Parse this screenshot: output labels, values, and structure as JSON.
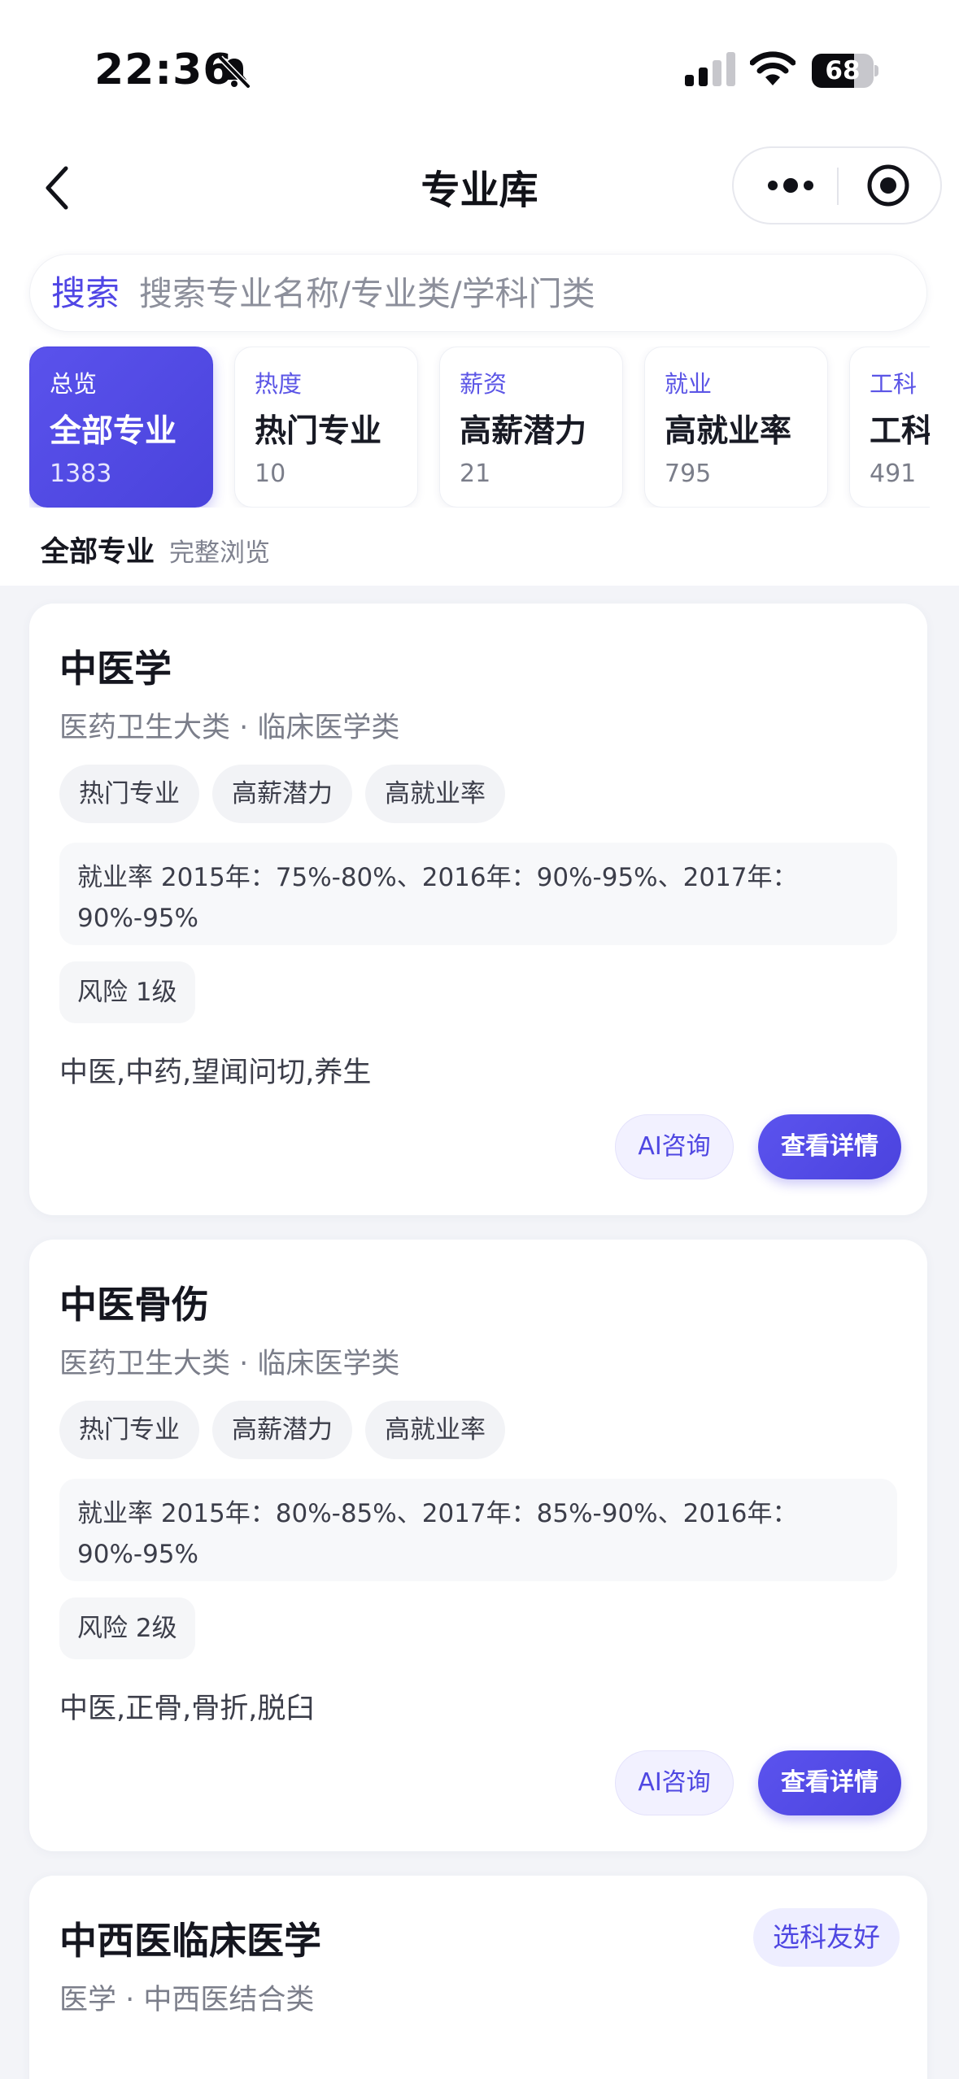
{
  "status_bar": {
    "time": "22:36",
    "battery": "68",
    "battery_level": 0.68
  },
  "nav": {
    "title": "专业库"
  },
  "search": {
    "label": "搜索",
    "placeholder": "搜索专业名称/专业类/学科门类"
  },
  "categories": [
    {
      "kicker": "总览",
      "title": "全部专业",
      "count": "1383",
      "active": true
    },
    {
      "kicker": "热度",
      "title": "热门专业",
      "count": "10",
      "active": false
    },
    {
      "kicker": "薪资",
      "title": "高薪潜力",
      "count": "21",
      "active": false
    },
    {
      "kicker": "就业",
      "title": "高就业率",
      "count": "795",
      "active": false
    },
    {
      "kicker": "工科",
      "title": "工科",
      "count": "491",
      "active": false
    }
  ],
  "section": {
    "title": "全部专业",
    "subtitle": "完整浏览"
  },
  "majors": [
    {
      "name": "中医学",
      "path": "医药卫生大类 · 临床医学类",
      "tags": [
        "热门专业",
        "高薪潜力",
        "高就业率"
      ],
      "employment": "就业率 2015年：75%-80%、2016年：90%-95%、2017年：90%-95%",
      "risk": "风险 1级",
      "keywords": "中医,中药,望闻问切,养生",
      "ai_label": "AI咨询",
      "detail_label": "查看详情"
    },
    {
      "name": "中医骨伤",
      "path": "医药卫生大类 · 临床医学类",
      "tags": [
        "热门专业",
        "高薪潜力",
        "高就业率"
      ],
      "employment": "就业率 2015年：80%-85%、2017年：85%-90%、2016年：90%-95%",
      "risk": "风险 2级",
      "keywords": "中医,正骨,骨折,脱臼",
      "ai_label": "AI咨询",
      "detail_label": "查看详情"
    },
    {
      "name": "中西医临床医学",
      "path": "医学 · 中西医结合类",
      "badge": "选科友好"
    }
  ],
  "colors": {
    "accent": "#5046e5",
    "background": "#f3f4f8"
  }
}
